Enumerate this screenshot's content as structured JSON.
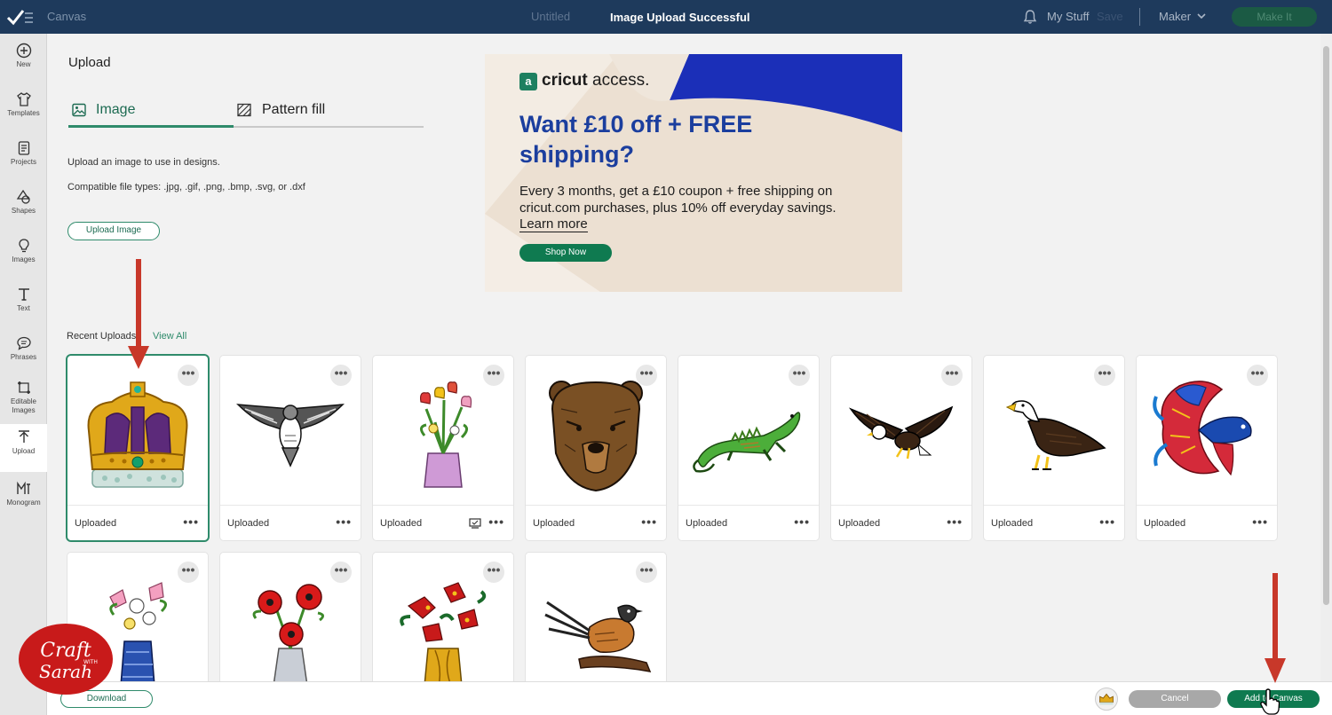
{
  "topbar": {
    "app_name": "Canvas",
    "document_title": "Untitled",
    "status_message": "Image Upload Successful",
    "my_stuff": "My Stuff",
    "save": "Save",
    "machine": "Maker",
    "make_it": "Make It"
  },
  "sidebar": {
    "items": [
      {
        "label": "New",
        "icon": "plus-circle-icon"
      },
      {
        "label": "Templates",
        "icon": "shirt-icon"
      },
      {
        "label": "Projects",
        "icon": "projects-icon"
      },
      {
        "label": "Shapes",
        "icon": "shapes-icon"
      },
      {
        "label": "Images",
        "icon": "lightbulb-icon"
      },
      {
        "label": "Text",
        "icon": "text-icon"
      },
      {
        "label": "Phrases",
        "icon": "speech-bubble-icon"
      },
      {
        "label": "Editable Images",
        "icon": "editable-images-icon"
      },
      {
        "label": "Upload",
        "icon": "upload-icon",
        "active": true
      },
      {
        "label": "Monogram",
        "icon": "monogram-icon"
      }
    ]
  },
  "panel": {
    "title": "Upload",
    "tabs": [
      {
        "label": "Image",
        "active": true
      },
      {
        "label": "Pattern fill",
        "active": false
      }
    ],
    "description": "Upload an image to use in designs.",
    "file_types": "Compatible file types: .jpg, .gif, .png, .bmp, .svg, or .dxf",
    "upload_button": "Upload Image"
  },
  "ad": {
    "logo_mark": "a",
    "logo_brand": "cricut",
    "logo_suffix": " access.",
    "headline": "Want £10 off + FREE shipping?",
    "body": "Every 3 months, get a £10 coupon + free shipping on cricut.com purchases, plus 10% off everyday savings.",
    "learn_more": "Learn more",
    "shop_now": "Shop Now",
    "colors": {
      "background": "#ece0d2",
      "accent": "#1b3e9e",
      "button": "#0f7a50"
    }
  },
  "recent": {
    "label": "Recent Uploads",
    "view_all": "View All",
    "items": [
      {
        "subject": "crown",
        "status": "Uploaded",
        "selected": true
      },
      {
        "subject": "hawk",
        "status": "Uploaded"
      },
      {
        "subject": "tulip-vase",
        "status": "Uploaded",
        "cut_icon": true
      },
      {
        "subject": "bear",
        "status": "Uploaded"
      },
      {
        "subject": "iguana",
        "status": "Uploaded"
      },
      {
        "subject": "eagle-flying",
        "status": "Uploaded"
      },
      {
        "subject": "eagle-perched",
        "status": "Uploaded"
      },
      {
        "subject": "betta-fish",
        "status": "Uploaded"
      },
      {
        "subject": "lily-vase"
      },
      {
        "subject": "poppy-vase"
      },
      {
        "subject": "poinsettia-vase"
      },
      {
        "subject": "fantail-bird"
      }
    ],
    "menu_glyph": "•••"
  },
  "bottombar": {
    "download": "Download",
    "cancel": "Cancel",
    "add_to_canvas": "Add to Canvas"
  },
  "watermark": {
    "text": "Craft with Sarah"
  },
  "colors": {
    "brand_green": "#2f8b6b",
    "topbar": "#1e3a5c",
    "annotation_arrow": "#c8382a"
  }
}
